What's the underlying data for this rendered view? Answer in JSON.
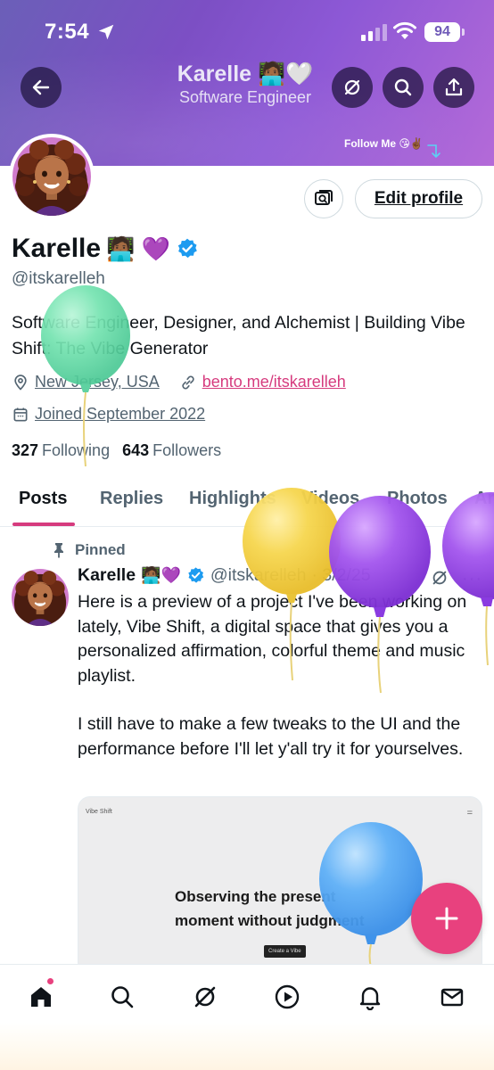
{
  "status_bar": {
    "time": "7:54",
    "battery": "94"
  },
  "header": {
    "name": "Karelle",
    "name_emoji": "🧑🏾‍💻🤍",
    "subtitle": "Software Engineer",
    "banner_caption": "Follow Me 😘✌🏾"
  },
  "actions": {
    "edit_profile": "Edit profile"
  },
  "profile": {
    "display_name": "Karelle",
    "name_emojis": "🧑🏾‍💻 💜",
    "handle": "@itskarelleh",
    "bio": "Software Engineer, Designer, and Alchemist | Building Vibe Shift: The Vibe Generator",
    "location": "New Jersey, USA",
    "website": "bento.me/itskarelleh",
    "joined": "Joined September 2022",
    "following_count": "327",
    "following_label": "Following",
    "followers_count": "643",
    "followers_label": "Followers"
  },
  "tabs": [
    {
      "label": "Posts",
      "active": true
    },
    {
      "label": "Replies",
      "active": false
    },
    {
      "label": "Highlights",
      "active": false
    },
    {
      "label": "Videos",
      "active": false
    },
    {
      "label": "Photos",
      "active": false
    },
    {
      "label": "Ar",
      "active": false
    }
  ],
  "post": {
    "pinned_label": "Pinned",
    "author": "Karelle",
    "author_emojis": "🧑🏾‍💻💜",
    "handle": "@itskarelleh",
    "date": "· 3/2/25",
    "paragraph_1": "Here is a preview of a project I've been working on lately, Vibe Shift, a digital space that gives you a personalized affirmation, colorful theme and music playlist.",
    "paragraph_2": "I still have to make a few tweaks to the UI and the performance before I'll let y'all try it for yourselves.",
    "media": {
      "app_title": "Vibe Shift",
      "menu": "=",
      "heading_line_1": "Observing the present",
      "heading_line_2": "moment without judgment",
      "cta": "Create a Vibe"
    }
  },
  "colors": {
    "accent": "#e8417e",
    "link": "#d63b7e",
    "verified": "#1d9bf0",
    "muted_text": "#536471",
    "banner": "#7c4fc4"
  },
  "icons": {
    "back": "arrow-left-icon",
    "grok": "grok-icon",
    "search": "search-icon",
    "share": "share-icon",
    "location": "location-pin-icon",
    "link": "link-icon",
    "calendar": "calendar-icon",
    "pin": "pin-icon",
    "compose": "plus-icon",
    "nav": [
      "home-icon",
      "search-icon",
      "grok-icon",
      "play-icon",
      "bell-icon",
      "mail-icon"
    ]
  }
}
